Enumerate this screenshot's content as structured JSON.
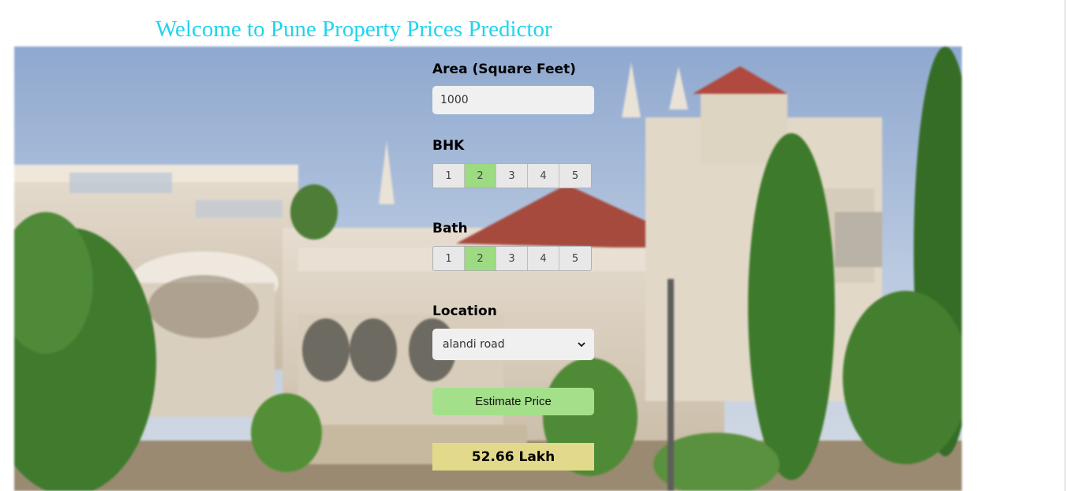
{
  "page": {
    "title": "Welcome to Pune Property Prices Predictor"
  },
  "form": {
    "area": {
      "label": "Area (Square Feet)",
      "value": "1000"
    },
    "bhk": {
      "label": "BHK",
      "options": [
        "1",
        "2",
        "3",
        "4",
        "5"
      ],
      "selected": "2"
    },
    "bath": {
      "label": "Bath",
      "options": [
        "1",
        "2",
        "3",
        "4",
        "5"
      ],
      "selected": "2"
    },
    "location": {
      "label": "Location",
      "value": "alandi road"
    },
    "estimate_button": "Estimate Price",
    "result": "52.66 Lakh"
  },
  "colors": {
    "title": "#22d3ee",
    "selected_option": "#9ddb82",
    "button": "#a4e08a",
    "result_bg": "#e3d98a"
  },
  "icons": {
    "select_arrow": "chevron-down-icon",
    "background": "aga-khan-palace-photo"
  }
}
